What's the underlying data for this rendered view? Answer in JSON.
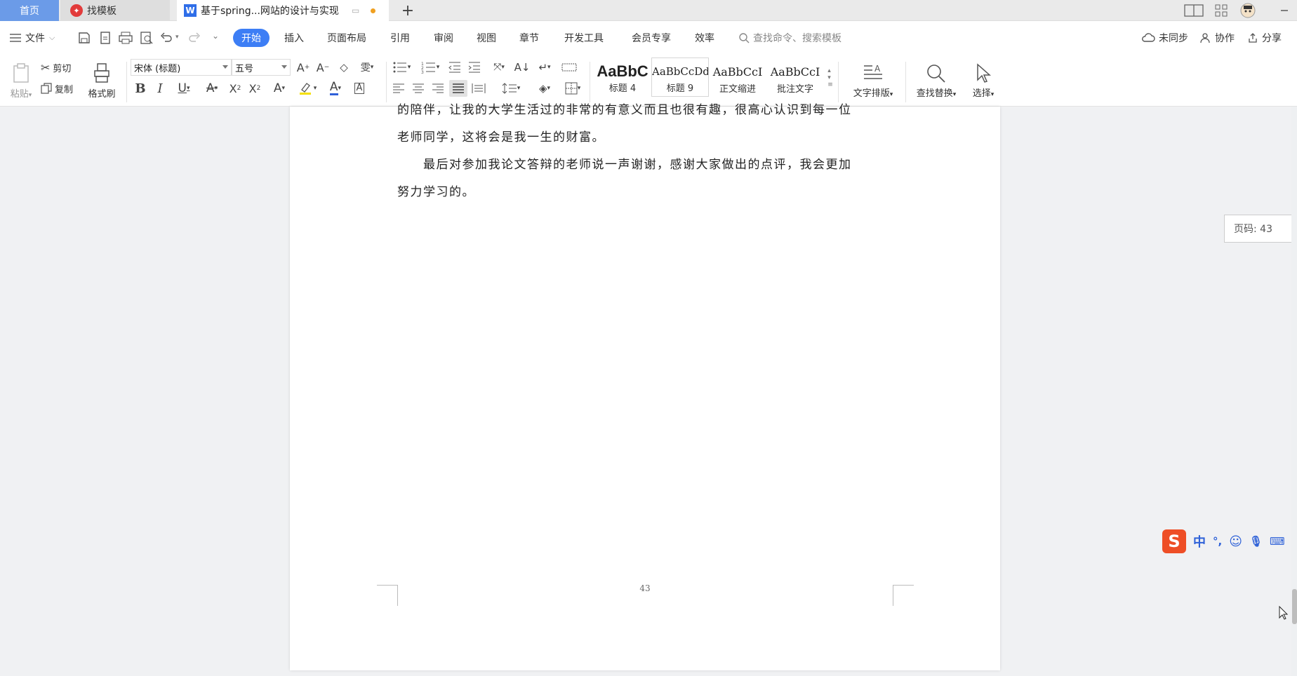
{
  "tabs": {
    "home": "首页",
    "template": "找模板",
    "document": "基于spring...网站的设计与实现"
  },
  "menu": {
    "file": "文件",
    "items": [
      "开始",
      "插入",
      "页面布局",
      "引用",
      "审阅",
      "视图",
      "章节",
      "开发工具",
      "会员专享",
      "效率"
    ],
    "active_index": 0,
    "search_placeholder": "查找命令、搜索模板",
    "sync": "未同步",
    "collab": "协作",
    "share": "分享"
  },
  "ribbon": {
    "paste": "粘贴",
    "cut": "剪切",
    "copy": "复制",
    "format_painter": "格式刷",
    "font_name": "宋体 (标题)",
    "font_size": "五号",
    "styles": [
      {
        "sample": "AaBbC",
        "name": "标题 4"
      },
      {
        "sample": "AaBbCcDd",
        "name": "标题 9"
      },
      {
        "sample": "AaBbCcI",
        "name": "正文缩进"
      },
      {
        "sample": "AaBbCcI",
        "name": "批注文字"
      }
    ],
    "text_layout": "文字排版",
    "find_replace": "查找替换",
    "select": "选择"
  },
  "document": {
    "paragraphs": [
      "的陪伴，让我的大学生活过的非常的有意义而且也很有趣，很高心认识到每一位",
      "老师同学，这将会是我一生的财富。",
      "　　最后对参加我论文答辩的老师说一声谢谢，感谢大家做出的点评，我会更加",
      "努力学习的。"
    ],
    "footer_page_number": "43"
  },
  "page_indicator": "页码: 43",
  "ime": {
    "mode": "中",
    "punct": "°,"
  },
  "colors": {
    "accent": "#3d7ef5",
    "home_tab": "#6b9be8",
    "ime_logo": "#ee4e26"
  }
}
